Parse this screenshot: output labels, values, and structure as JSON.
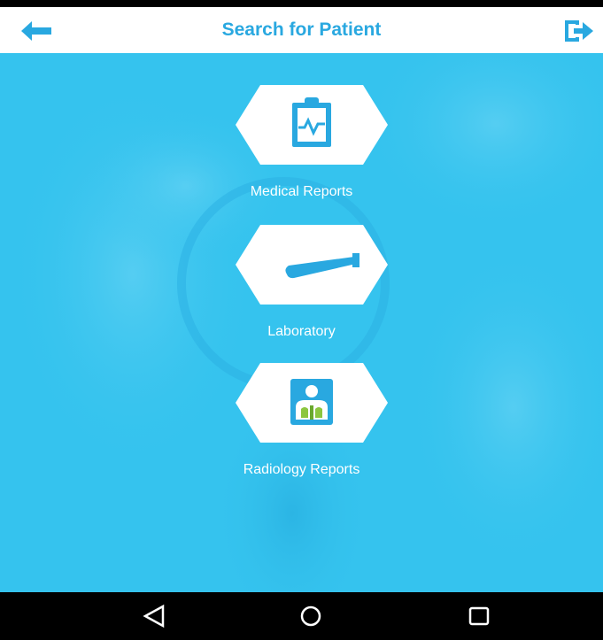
{
  "app_bar": {
    "title": "Search for Patient",
    "back_icon": "arrow-left-icon",
    "logout_icon": "logout-icon"
  },
  "menu": {
    "items": [
      {
        "label": "Medical Reports",
        "icon": "clipboard-chart-icon"
      },
      {
        "label": "Laboratory",
        "icon": "test-tube-icon"
      },
      {
        "label": "Radiology Reports",
        "icon": "xray-chest-icon"
      }
    ]
  },
  "android_nav": {
    "back_icon": "triangle-back-icon",
    "home_icon": "circle-home-icon",
    "recents_icon": "square-recents-icon"
  },
  "colors": {
    "primary": "#29a8e0",
    "overlay": "#35c3ee",
    "tile_fill": "#ffffff",
    "nav_bar": "#000000",
    "accent_green": "#8cc63f"
  }
}
